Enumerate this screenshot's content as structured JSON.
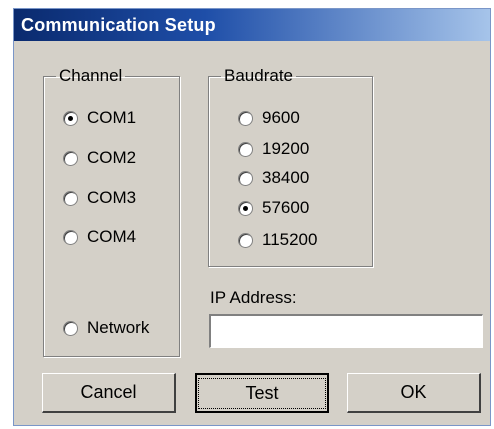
{
  "window": {
    "title": "Communication Setup"
  },
  "channel": {
    "legend": "Channel",
    "options": [
      "COM1",
      "COM2",
      "COM3",
      "COM4",
      "Network"
    ],
    "selected": "COM1"
  },
  "baudrate": {
    "legend": "Baudrate",
    "options": [
      "9600",
      "19200",
      "38400",
      "57600",
      "115200"
    ],
    "selected": "57600"
  },
  "ip": {
    "label": "IP Address:",
    "value": ""
  },
  "buttons": {
    "cancel": "Cancel",
    "test": "Test",
    "ok": "OK"
  }
}
